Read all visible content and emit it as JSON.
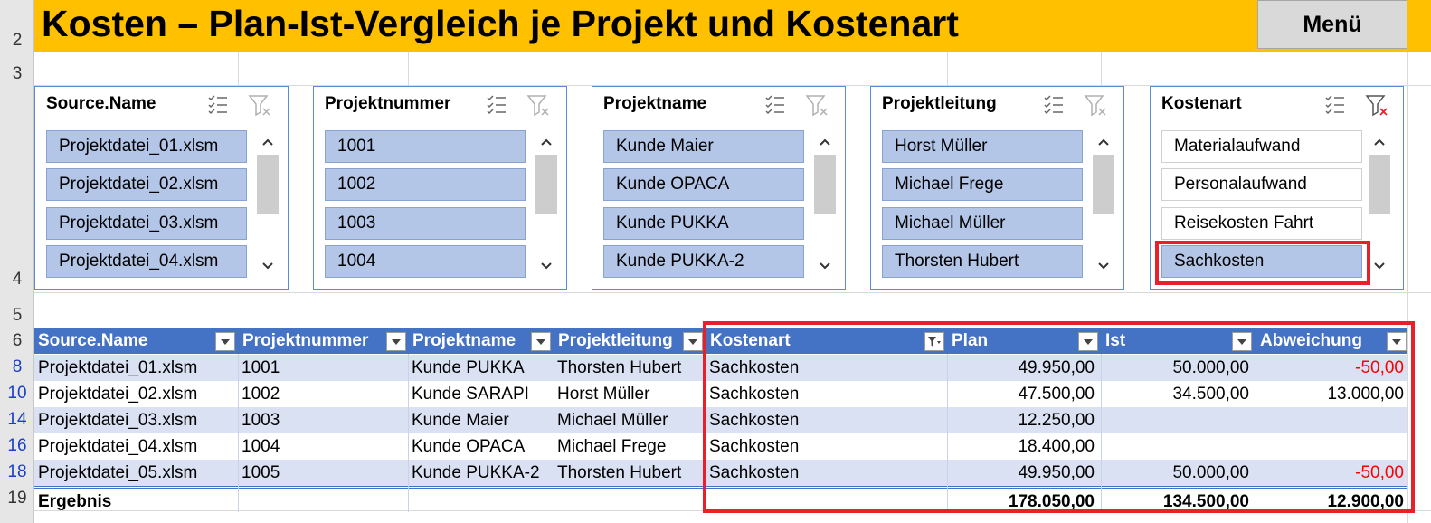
{
  "title": "Kosten – Plan-Ist-Vergleich je Projekt und Kostenart",
  "menu_label": "Menü",
  "row_numbers": [
    "2",
    "3",
    "4",
    "5",
    "6",
    "8",
    "10",
    "14",
    "16",
    "18",
    "19"
  ],
  "slicers": [
    {
      "header": "Source.Name",
      "items": [
        "Projektdatei_01.xlsm",
        "Projektdatei_02.xlsm",
        "Projektdatei_03.xlsm",
        "Projektdatei_04.xlsm"
      ]
    },
    {
      "header": "Projektnummer",
      "items": [
        "1001",
        "1002",
        "1003",
        "1004"
      ]
    },
    {
      "header": "Projektname",
      "items": [
        "Kunde Maier",
        "Kunde OPACA",
        "Kunde PUKKA",
        "Kunde PUKKA-2"
      ]
    },
    {
      "header": "Projektleitung",
      "items": [
        "Horst Müller",
        "Michael Frege",
        "Michael Müller",
        "Thorsten Hubert"
      ]
    },
    {
      "header": "Kostenart",
      "items": [
        "Materialaufwand",
        "Personalaufwand",
        "Reisekosten Fahrt",
        "Sachkosten"
      ],
      "selected_index": 3
    }
  ],
  "table": {
    "headers": [
      "Source.Name",
      "Projektnummer",
      "Projektname",
      "Projektleitung",
      "Kostenart",
      "Plan",
      "Ist",
      "Abweichung"
    ],
    "rows": [
      [
        "Projektdatei_01.xlsm",
        "1001",
        "Kunde PUKKA",
        "Thorsten Hubert",
        "Sachkosten",
        "49.950,00",
        "50.000,00",
        "-50,00"
      ],
      [
        "Projektdatei_02.xlsm",
        "1002",
        "Kunde SARAPI",
        "Horst Müller",
        "Sachkosten",
        "47.500,00",
        "34.500,00",
        "13.000,00"
      ],
      [
        "Projektdatei_03.xlsm",
        "1003",
        "Kunde Maier",
        "Michael Müller",
        "Sachkosten",
        "12.250,00",
        "",
        ""
      ],
      [
        "Projektdatei_04.xlsm",
        "1004",
        "Kunde OPACA",
        "Michael Frege",
        "Sachkosten",
        "18.400,00",
        "",
        ""
      ],
      [
        "Projektdatei_05.xlsm",
        "1005",
        "Kunde PUKKA-2",
        "Thorsten Hubert",
        "Sachkosten",
        "49.950,00",
        "50.000,00",
        "-50,00"
      ]
    ],
    "total": {
      "label": "Ergebnis",
      "plan": "178.050,00",
      "ist": "134.500,00",
      "abweichung": "12.900,00"
    }
  },
  "colors": {
    "title_band": "#ffc000",
    "header_fill": "#4472c4",
    "band_fill": "#d9e1f2",
    "slicer_selected": "#b4c6e7",
    "highlight_box": "#e8202a",
    "negative": "#ff0000"
  }
}
